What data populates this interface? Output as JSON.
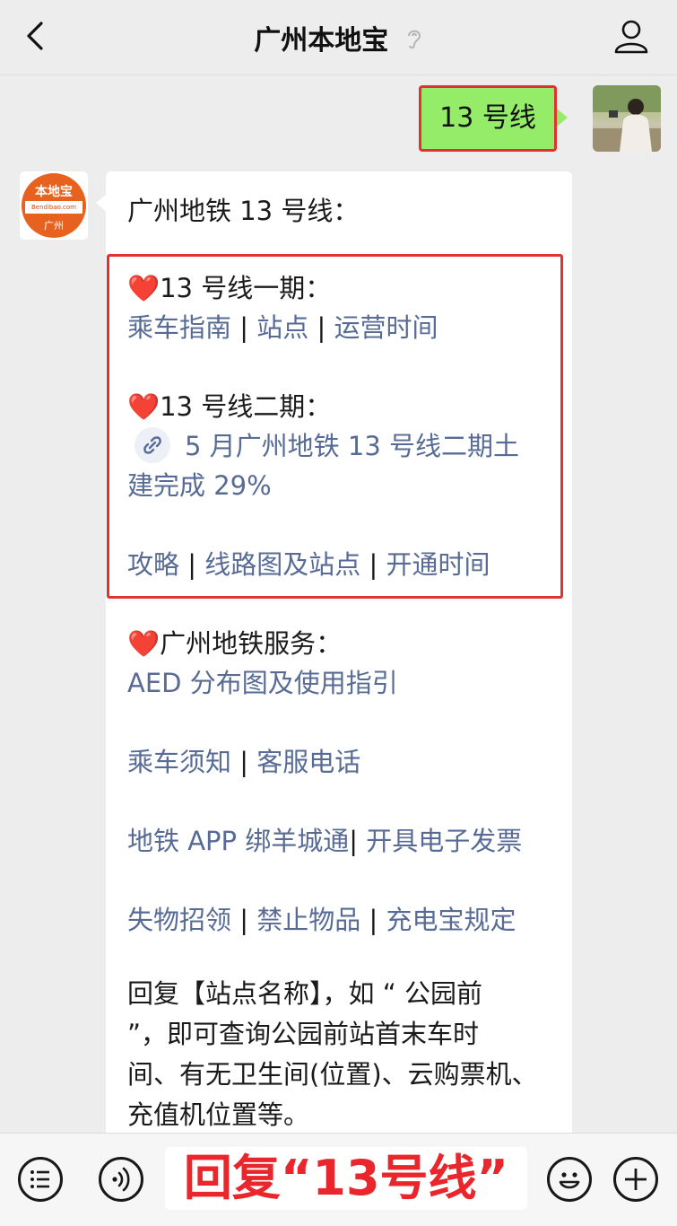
{
  "header": {
    "title": "广州本地宝",
    "back_icon": "chevron-left-icon",
    "ear_icon": "ear-icon",
    "profile_icon": "user-icon"
  },
  "outgoing": {
    "text": "13 号线"
  },
  "avatar_logo": {
    "top": "本地宝",
    "mid": "Bendibao.com",
    "bot": "广州"
  },
  "message": {
    "title": "广州地铁 13 号线：",
    "phase1": {
      "heart": "❤️",
      "heading": "13 号线一期：",
      "links": [
        "乘车指南",
        "站点",
        "运营时间"
      ]
    },
    "phase2": {
      "heart": "❤️",
      "heading": "13 号线二期：",
      "mini_link_line1": "5 月广州地铁 13 号线二期土",
      "mini_link_line2": "建完成 29%",
      "links": [
        "攻略",
        "线路图及站点",
        "开通时间"
      ]
    },
    "service": {
      "heart": "❤️",
      "heading": "广州地铁服务：",
      "aed": "AED 分布图及使用指引",
      "row1": [
        "乘车须知",
        "客服电话"
      ],
      "row2": [
        "地铁 APP 绑羊城通",
        "开具电子发票"
      ],
      "row3": [
        "失物招领",
        "禁止物品",
        "充电宝规定"
      ]
    },
    "reply_para": [
      "回复【站点名称】，如 “ 公园前",
      "”，即可查询公园前站首末车时",
      "间、有无卫生间(位置)、云购票机、",
      "充值机位置等。"
    ],
    "separator": "|"
  },
  "bottom": {
    "menu_icon": "list-menu-icon",
    "voice_icon": "voice-icon",
    "reply_hint": "回复“13号线”",
    "emoji_icon": "emoji-icon",
    "plus_icon": "plus-icon"
  },
  "colors": {
    "link": "#576b95",
    "bubble_green": "#95ec69",
    "highlight_red": "#e0322e"
  }
}
